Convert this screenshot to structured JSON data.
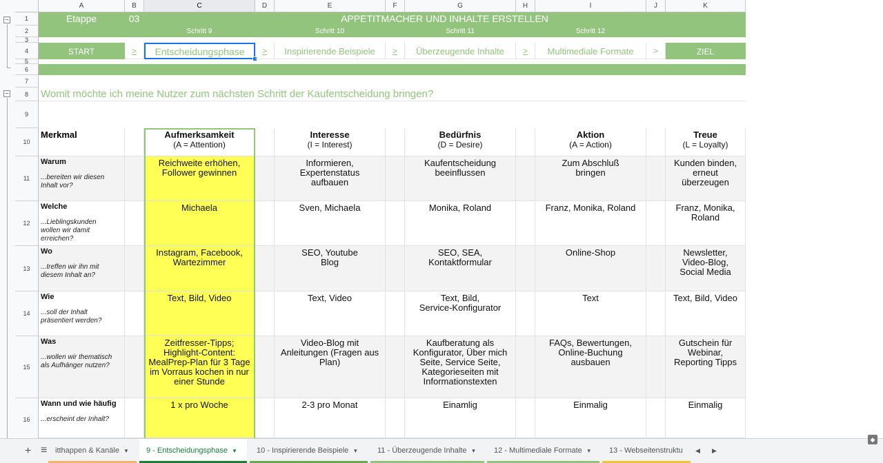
{
  "columns": [
    "A",
    "B",
    "C",
    "D",
    "E",
    "F",
    "G",
    "H",
    "I",
    "J",
    "K"
  ],
  "rows": [
    "1",
    "2",
    "3",
    "4",
    "5",
    "6",
    "7",
    "8",
    "9",
    "10",
    "11",
    "12",
    "13",
    "14",
    "15",
    "16"
  ],
  "banner": {
    "etappe_label": "Etappe",
    "etappe_number": "03",
    "title": "APPETITMACHER UND INHALTE ERSTELLEN",
    "schritte": [
      "Schritt 9",
      "Schritt 10",
      "Schritt 11",
      "Schritt 12"
    ]
  },
  "phases": {
    "start": "START",
    "arrow": ">",
    "steps": [
      "Entscheidungsphase",
      "Inspirierende Beispiele",
      "Überzeugende Inhalte",
      "Multimediale Formate"
    ],
    "ziel": "ZIEL"
  },
  "question": "Womit möchte ich meine Nutzer zum nächsten Schritt der Kaufentscheidung bringen?",
  "table": {
    "corner_label": "Merkmal",
    "headers": [
      {
        "title": "Aufmerksamkeit",
        "sub": "(A = Attention)"
      },
      {
        "title": "Interesse",
        "sub": "(I = Interest)"
      },
      {
        "title": "Bedürfnis",
        "sub": "(D = Desire)"
      },
      {
        "title": "Aktion",
        "sub": "(A = Action)"
      },
      {
        "title": "Treue",
        "sub": "(L = Loyalty)"
      }
    ],
    "rows": [
      {
        "label": "Warum",
        "sub": "...bereiten wir diesen\nInhalt vor?",
        "cells": [
          "Reichweite erhöhen,\nFollower gewinnen",
          "Informieren,\nExpertenstatus\naufbauen",
          "Kaufentscheidung\nbeeinflussen",
          "Zum Abschluß\nbringen",
          "Kunden binden,\nerneut\nüberzeugen"
        ]
      },
      {
        "label": "Welche",
        "sub": "...Lieblingskunden\nwollen wir damit\nerreichen?",
        "cells": [
          "Michaela",
          "Sven, Michaela",
          "Monika, Roland",
          "Franz, Monika, Roland",
          "Franz, Monika,\nRoland"
        ]
      },
      {
        "label": "Wo",
        "sub": "...treffen wir ihn mit\ndiesem Inhalt an?",
        "cells": [
          "Instagram, Facebook,\nWartezimmer",
          "SEO, Youtube\nBlog",
          "SEO, SEA,\nKontaktformular",
          "Online-Shop",
          "Newsletter,\nVideo-Blog,\nSocial Media"
        ]
      },
      {
        "label": "Wie",
        "sub": "...soll der Inhalt\npräsentiert werden?",
        "cells": [
          "Text, Bild, Video",
          "Text, Video",
          "Text, Bild,\nService-Konfigurator",
          "Text",
          "Text, Bild, Video"
        ]
      },
      {
        "label": "Was",
        "sub": "...wollen wir thematisch\nals Aufhänger nutzen?",
        "cells": [
          "Zeitfresser-Tipps;\nHighlight-Content:\nMealPrep-Plan für 3 Tage\nim Vorraus kochen in nur\neiner Stunde",
          "Video-Blog mit\nAnleitungen (Fragen aus\nPlan)",
          "Kaufberatung als\nKonfigurator, Über mich\nSeite, Service Seite,\nKategorieseiten mit\nInformationstexten",
          "FAQs, Bewertungen,\nOnline-Buchung\nausbauen",
          "Gutschein für\nWebinar,\nReporting Tipps"
        ]
      },
      {
        "label": "Wann und wie häufig",
        "sub": "...erscheint der Inhalt?",
        "cells": [
          "1 x pro Woche",
          "2-3 pro Monat",
          "Einamlig",
          "Einmalig",
          "Einmalig"
        ]
      }
    ]
  },
  "tabs": [
    {
      "label": "itthappen & Kanäle",
      "color": "#f6b26b"
    },
    {
      "label": "9 - Entscheidungsphase",
      "color": "#188038"
    },
    {
      "label": "10 - Inspirierende Beispiele",
      "color": "#6aa84f"
    },
    {
      "label": "11 - Überzeugende Inhalte",
      "color": "#93c47d"
    },
    {
      "label": "12 - Multimediale Formate",
      "color": "#93c47d"
    },
    {
      "label": "13 - Webseitenstruktu",
      "color": "#f1c232"
    }
  ],
  "icons": {
    "add": "+",
    "sheets_list": "≡",
    "prev": "◀",
    "next": "▶",
    "explore": "◆",
    "caret": "▼"
  }
}
